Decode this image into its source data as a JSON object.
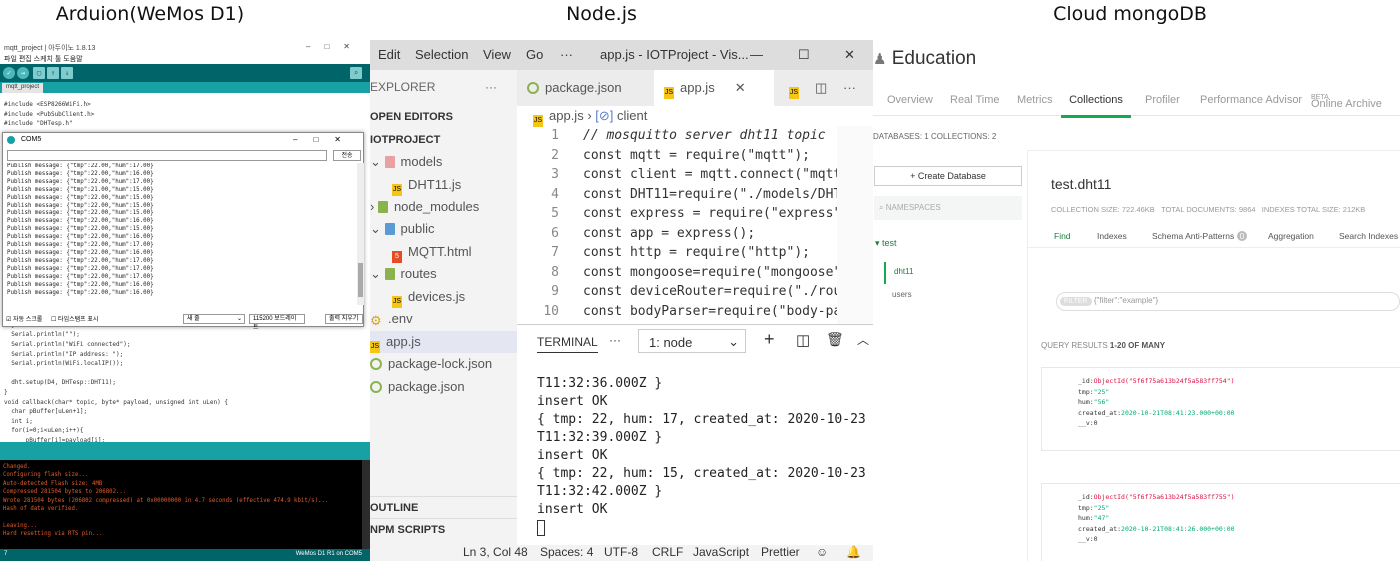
{
  "captions": {
    "arduino": "Arduion(WeMos D1)",
    "node": "Node.js",
    "mongo": "Cloud mongoDB"
  },
  "arduino": {
    "window_title": "mqtt_project | 아두이노 1.8.13",
    "menu": "파일  편집  스케치  툴  도움말",
    "tab": "mqtt_project",
    "code_top": [
      "#include <ESP8266WiFi.h>",
      "#include <PubSubClient.h>",
      "#include \"DHTesp.h\""
    ],
    "code_bottom": [
      "  }",
      "  Serial.println(\"\");",
      "  Serial.println(\"WiFi connected\");",
      "  Serial.println(\"IP address: \");",
      "  Serial.println(WiFi.localIP());",
      "",
      "  dht.setup(D4, DHTesp::DHT11);",
      "}",
      "void callback(char* topic, byte* payload, unsigned int uLen) {",
      "  char pBuffer[uLen+1];",
      "  int i;",
      "  for(i=0;i<uLen;i++){",
      "      pBuffer[i]=payload[i];"
    ],
    "console": [
      "Changed.",
      "Configuring flash size...",
      "Auto-detected Flash size: 4MB",
      "Compressed 281504 bytes to 206802...",
      "Wrote 281504 bytes (206802 compressed) at 0x00000000 in 4.7 seconds (effective 474.9 kbit/s)...",
      "Hash of data verified.",
      "",
      "Leaving...",
      "Hard resetting via RTS pin..."
    ],
    "status_left": "7",
    "status_right": "WeMos D1 R1 on COM5",
    "serial": {
      "title": "COM5",
      "send": "전송",
      "messages": [
        "Publish message: {\"tmp\":22.00,\"hum\":17.00}",
        "Publish message: {\"tmp\":22.00,\"hum\":16.00}",
        "Publish message: {\"tmp\":22.00,\"hum\":17.00}",
        "Publish message: {\"tmp\":21.00,\"hum\":15.00}",
        "Publish message: {\"tmp\":22.00,\"hum\":15.00}",
        "Publish message: {\"tmp\":22.00,\"hum\":15.00}",
        "Publish message: {\"tmp\":22.00,\"hum\":15.00}",
        "Publish message: {\"tmp\":22.00,\"hum\":16.00}",
        "Publish message: {\"tmp\":22.00,\"hum\":15.00}",
        "Publish message: {\"tmp\":22.00,\"hum\":16.00}",
        "Publish message: {\"tmp\":22.00,\"hum\":17.00}",
        "Publish message: {\"tmp\":22.00,\"hum\":16.00}",
        "Publish message: {\"tmp\":22.00,\"hum\":17.00}",
        "Publish message: {\"tmp\":22.00,\"hum\":17.00}",
        "Publish message: {\"tmp\":22.00,\"hum\":17.00}",
        "Publish message: {\"tmp\":22.00,\"hum\":16.00}",
        "Publish message: {\"tmp\":22.00,\"hum\":16.00}"
      ],
      "autoscroll": "자동 스크롤",
      "timestamp": "타임스탬프 표시",
      "line_ending": "새 줄",
      "baud": "115200 보드레이트",
      "clear": "출력 지우기"
    }
  },
  "vscode": {
    "menu": [
      "Edit",
      "Selection",
      "View",
      "Go",
      "···"
    ],
    "title": "app.js - IOTProject - Vis...",
    "explorer": "EXPLORER",
    "open_editors": "OPEN EDITORS",
    "project": "IOTPROJECT",
    "tree": [
      "models",
      "DHT11.js",
      "node_modules",
      "public",
      "MQTT.html",
      "routes",
      "devices.js",
      ".env",
      "app.js",
      "package-lock.json",
      "package.json"
    ],
    "outline": "OUTLINE",
    "npm": "NPM SCRIPTS",
    "tabs": [
      "package.json",
      "app.js"
    ],
    "breadcrumb": [
      "app.js",
      "client"
    ],
    "line_numbers": [
      "1",
      "2",
      "3",
      "4",
      "5",
      "6",
      "7",
      "8",
      "9",
      "10"
    ],
    "code": [
      "// mosquitto server dht11 topic",
      "const mqtt = require(\"mqtt\");",
      "const client = mqtt.connect(\"mqtt",
      "const DHT11=require(\"./models/DHT",
      "const express = require(\"express\"",
      "const app = express();",
      "const http = require(\"http\");",
      "const mongoose=require(\"mongoose\"",
      "const deviceRouter=require(\"./rou",
      "const bodyParser=require(\"body-pa"
    ],
    "terminal_label": "TERMINAL",
    "terminal_select": "1: node",
    "terminal": [
      "T11:32:36.000Z }",
      "insert OK",
      "{ tmp: 22, hum: 17, created_at: 2020-10-23",
      "T11:32:39.000Z }",
      "insert OK",
      "{ tmp: 22, hum: 15, created_at: 2020-10-23",
      "T11:32:42.000Z }",
      "insert OK"
    ],
    "status": [
      "Ln 3, Col 48",
      "Spaces: 4",
      "UTF-8",
      "CRLF",
      "JavaScript",
      "Prettier"
    ]
  },
  "mongo": {
    "title": "Education",
    "nav": [
      "Overview",
      "Real Time",
      "Metrics",
      "Collections",
      "Profiler",
      "Performance Advisor",
      "Online Archive"
    ],
    "beta": "BETA",
    "dbinfo": "DATABASES: 1   COLLECTIONS: 2",
    "create_db": "+ Create Database",
    "namespaces": "NAMESPACES",
    "db": "test",
    "collections": [
      "dht11",
      "users"
    ],
    "collection_name": "test.dht11",
    "stats": [
      "COLLECTION SIZE: 722.46KB",
      "TOTAL DOCUMENTS: 9864",
      "INDEXES TOTAL SIZE: 212KB"
    ],
    "subtabs": [
      "Find",
      "Indexes",
      "Schema Anti-Patterns",
      "Aggregation",
      "Search Indexes"
    ],
    "antipattern_count": "0",
    "filter_label": "FILTER",
    "filter_placeholder": "{\"filter\":\"example\"}",
    "query_results": "QUERY RESULTS",
    "query_range": "1-20 OF MANY",
    "docs": [
      {
        "id": "ObjectId(\"5f6f75a613b24f5a583ff754\")",
        "tmp": "\"25\"",
        "hum": "\"56\"",
        "created_at": "2020-10-21T08:41:23.000+00:00",
        "v": "0"
      },
      {
        "id": "ObjectId(\"5f6f75a613b24f5a583ff755\")",
        "tmp": "\"25\"",
        "hum": "\"47\"",
        "created_at": "2020-10-21T08:41:26.000+00:00",
        "v": "0"
      }
    ]
  }
}
